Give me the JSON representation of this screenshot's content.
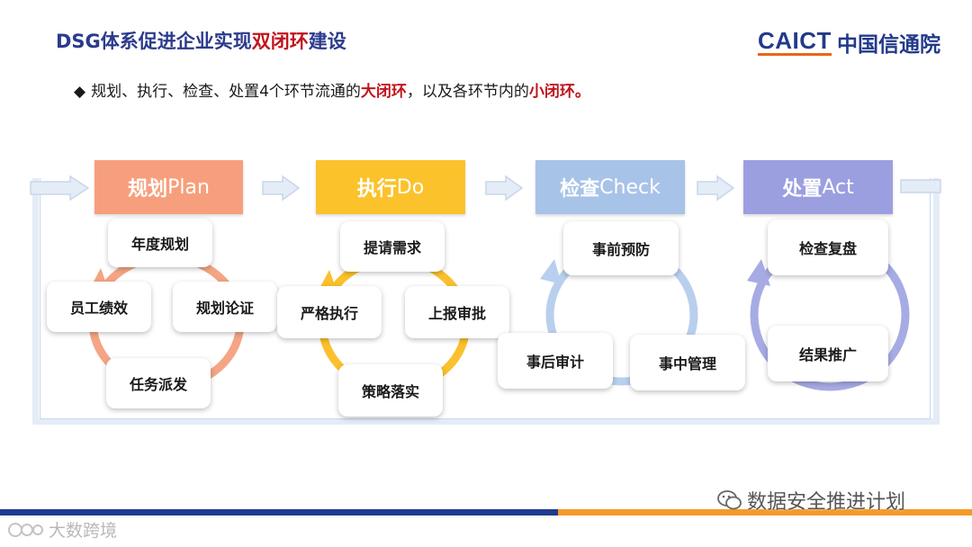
{
  "header": {
    "title_part1": "DSG体系促进企业实现",
    "title_highlight": "双闭环",
    "title_part2": "建设",
    "logo_text": "CAICT",
    "logo_cn": "中国信通院"
  },
  "bullet": {
    "symbol": "◆",
    "text_part1": "规划、执行、检查、处置4个环节流通的",
    "highlight1": "大闭环",
    "text_part2": "，以及各环节内的",
    "highlight2": "小闭环",
    "text_part3": "。"
  },
  "phases": [
    {
      "zh": "规划",
      "en": "Plan",
      "color": "#f79f7c",
      "ring_color": "#f4a584",
      "steps": [
        "年度规划",
        "规划论证",
        "任务派发",
        "员工绩效"
      ]
    },
    {
      "zh": "执行",
      "en": "Do",
      "color": "#fbc22b",
      "ring_color": "#fbc02d",
      "steps": [
        "提请需求",
        "上报审批",
        "策略落实",
        "严格执行"
      ]
    },
    {
      "zh": "检查",
      "en": "Check",
      "color": "#a8c3e8",
      "ring_color": "#b9cfee",
      "steps": [
        "事前预防",
        "事中管理",
        "事后审计"
      ]
    },
    {
      "zh": "处置",
      "en": "Act",
      "color": "#9b9fe0",
      "ring_color": "#a7abe4",
      "steps": [
        "检查复盘",
        "结果推广"
      ]
    }
  ],
  "footer": {
    "wechat_text": "数据安全推进计划",
    "watermark_left": "大数跨境"
  }
}
